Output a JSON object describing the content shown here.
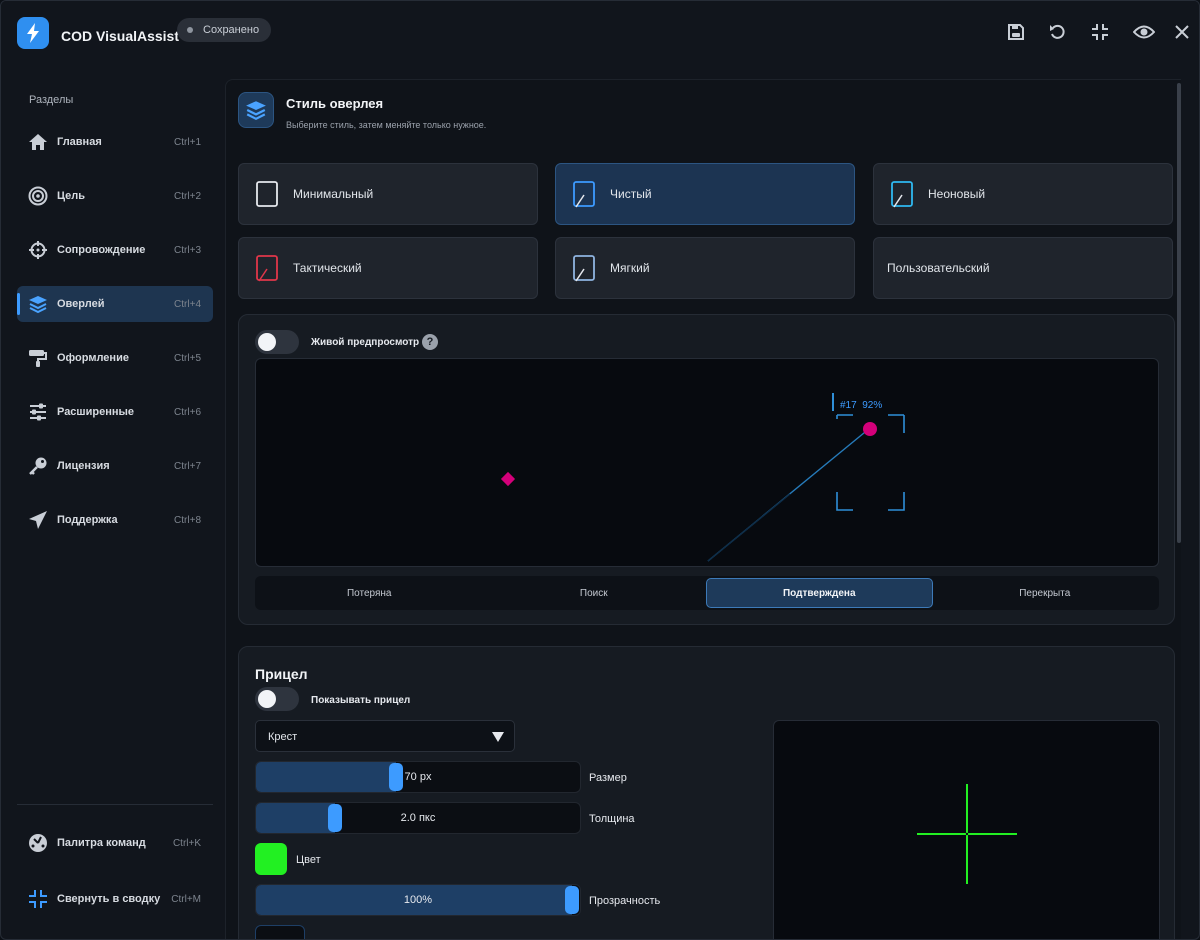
{
  "app": {
    "title": "COD VisualAssist",
    "saved_label": "Сохранено",
    "accent": "#2f8ff0"
  },
  "toolbar": {
    "icons": [
      "save-icon",
      "undo-icon",
      "compress-icon",
      "eye-icon",
      "close-icon"
    ]
  },
  "sidebar": {
    "section_label": "Разделы",
    "items": [
      {
        "id": "home",
        "label": "Главная",
        "shortcut": "Ctrl+1",
        "icon": "home-icon"
      },
      {
        "id": "target",
        "label": "Цель",
        "shortcut": "Ctrl+2",
        "icon": "target-icon"
      },
      {
        "id": "tracking",
        "label": "Сопровождение",
        "shortcut": "Ctrl+3",
        "icon": "crosshair-icon"
      },
      {
        "id": "overlay",
        "label": "Оверлей",
        "shortcut": "Ctrl+4",
        "icon": "layers-icon",
        "active": true
      },
      {
        "id": "appearance",
        "label": "Оформление",
        "shortcut": "Ctrl+5",
        "icon": "paint-roller-icon"
      },
      {
        "id": "advanced",
        "label": "Расширенные",
        "shortcut": "Ctrl+6",
        "icon": "sliders-icon"
      },
      {
        "id": "license",
        "label": "Лицензия",
        "shortcut": "Ctrl+7",
        "icon": "key-icon"
      },
      {
        "id": "support",
        "label": "Поддержка",
        "shortcut": "Ctrl+8",
        "icon": "send-icon"
      }
    ],
    "bottom_items": [
      {
        "id": "palette",
        "label": "Палитра команд",
        "shortcut": "Ctrl+K",
        "icon": "palette-icon"
      },
      {
        "id": "collapse",
        "label": "Свернуть в сводку",
        "shortcut": "Ctrl+M",
        "icon": "collapse-icon"
      }
    ]
  },
  "overlay_style": {
    "title": "Стиль оверлея",
    "subtitle": "Выберите стиль, затем меняйте только нужное.",
    "styles": [
      {
        "label": "Минимальный",
        "icon_color": "#e6e9ee"
      },
      {
        "label": "Чистый",
        "icon_color": "#3d9bff",
        "active": true
      },
      {
        "label": "Неоновый",
        "icon_color": "#2fb8f0"
      },
      {
        "label": "Тактический",
        "icon_color": "#e0364a"
      },
      {
        "label": "Мягкий",
        "icon_color": "#8fb4e0"
      },
      {
        "label": "Пользовательский"
      }
    ]
  },
  "live_preview": {
    "label": "Живой предпросмотр",
    "help": "?",
    "enabled": false,
    "target_label": "#17  92%",
    "states": [
      {
        "label": "Потеряна"
      },
      {
        "label": "Поиск"
      },
      {
        "label": "Подтверждена",
        "active": true
      },
      {
        "label": "Перекрыта"
      }
    ]
  },
  "crosshair": {
    "title": "Прицел",
    "show_label": "Показывать прицел",
    "show_enabled": false,
    "shape_value": "Крест",
    "size": {
      "value": "70 px",
      "label": "Размер",
      "fraction": 0.43
    },
    "thickness": {
      "value": "2.0 пкс",
      "label": "Толщина",
      "fraction": 0.23
    },
    "color": {
      "label": "Цвет",
      "value": "#22f022"
    },
    "opacity": {
      "value": "100%",
      "label": "Прозрачность",
      "fraction": 1.0
    }
  }
}
